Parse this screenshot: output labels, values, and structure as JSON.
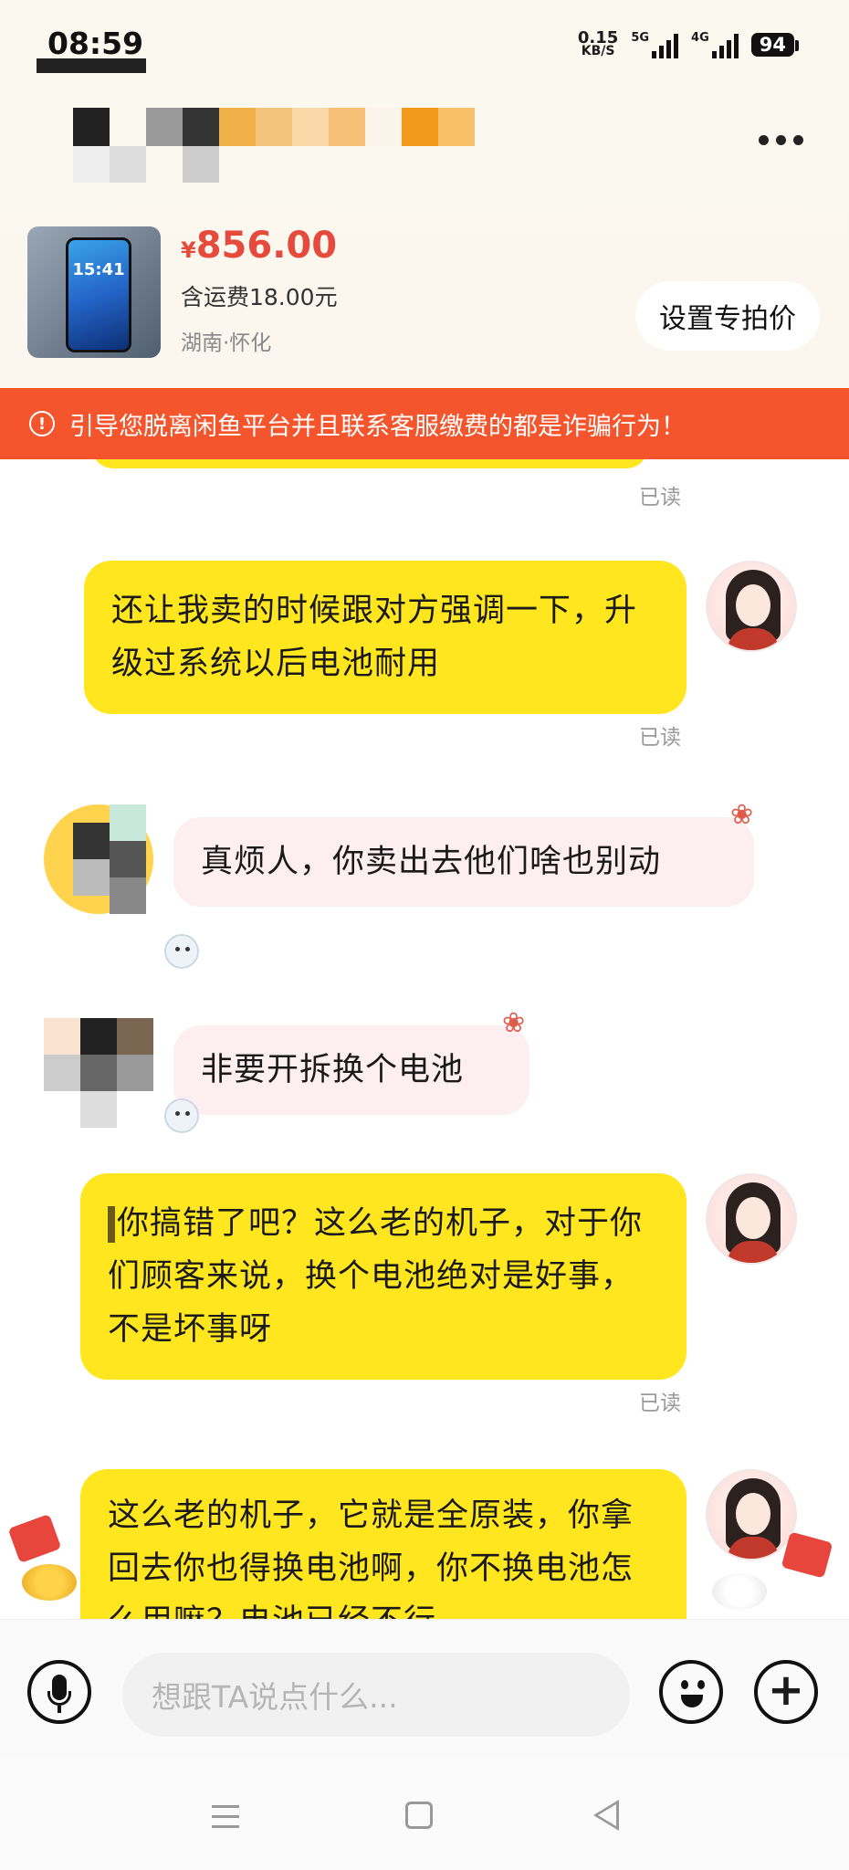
{
  "status_bar": {
    "time": "08:59",
    "net_speed_value": "0.15",
    "net_speed_unit": "KB/S",
    "signal1_label": "5G",
    "signal2_label": "4G",
    "battery": "94"
  },
  "product": {
    "thumb_time": "15:41",
    "price_symbol": "¥",
    "price": "856.00",
    "shipping": "含运费18.00元",
    "location": "湖南·怀化",
    "set_price_button": "设置专拍价"
  },
  "warning": {
    "text": "引导您脱离闲鱼平台并且联系客服缴费的都是诈骗行为！"
  },
  "messages": [
    {
      "read": "已读"
    },
    {
      "text": "还让我卖的时候跟对方强调一下，升级过系统以后电池耐用",
      "read": "已读"
    },
    {
      "text": "真烦人，你卖出去他们啥也别动"
    },
    {
      "text": "非要开拆换个电池"
    },
    {
      "text": "你搞错了吧？这么老的机子，对于你们顾客来说，换个电池绝对是好事，不是坏事呀",
      "read": "已读"
    },
    {
      "text": "这么老的机子，它就是全原装，你拿回去你也得换电池啊，你不换电池怎么用嘛？电池已经不行"
    }
  ],
  "input": {
    "placeholder": "想跟TA说点什么..."
  },
  "icons": {
    "mic": "microphone-icon",
    "emoji": "smiley-icon",
    "plus": "plus-icon",
    "more": "more-dots-icon",
    "warning": "exclamation-circle-icon"
  },
  "colors": {
    "my_bubble": "#ffe61f",
    "their_bubble": "#fdeef2",
    "warning_banner": "#f4552d",
    "price": "#e64a3d"
  }
}
